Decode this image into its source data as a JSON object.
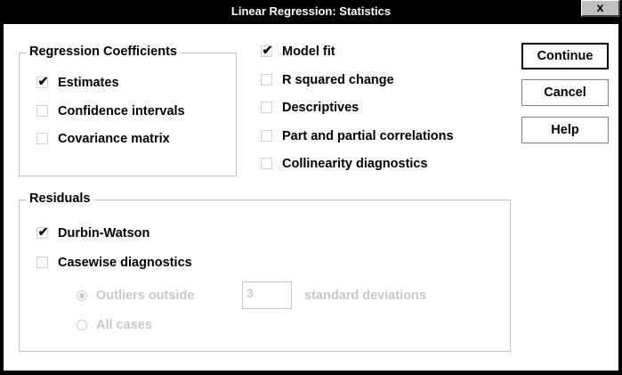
{
  "window": {
    "title": "Linear Regression: Statistics",
    "close_label": "x"
  },
  "coefficients": {
    "title": "Regression Coefficients",
    "items": [
      {
        "label": "Estimates",
        "checked": true
      },
      {
        "label": "Confidence intervals",
        "checked": false
      },
      {
        "label": "Covariance matrix",
        "checked": false
      }
    ]
  },
  "options": {
    "items": [
      {
        "label": "Model fit",
        "checked": true
      },
      {
        "label": "R squared change",
        "checked": false
      },
      {
        "label": "Descriptives",
        "checked": false
      },
      {
        "label": "Part and partial correlations",
        "checked": false
      },
      {
        "label": "Collinearity diagnostics",
        "checked": false
      }
    ]
  },
  "residuals": {
    "title": "Residuals",
    "durbin_watson": {
      "label": "Durbin-Watson",
      "checked": true
    },
    "casewise": {
      "label": "Casewise diagnostics",
      "checked": false
    },
    "outliers_label": "Outliers outside",
    "outliers_value": "3",
    "std_dev_label": "standard deviations",
    "all_cases_label": "All cases"
  },
  "buttons": {
    "continue": "Continue",
    "cancel": "Cancel",
    "help": "Help"
  }
}
